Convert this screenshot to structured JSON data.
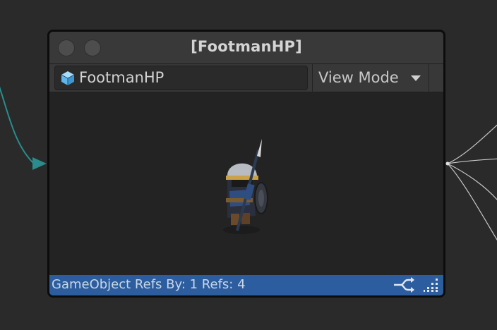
{
  "node": {
    "title": "[FootmanHP]",
    "object_field": {
      "label": "FootmanHP",
      "icon": "prefab-cube-icon"
    },
    "view_mode_label": "View Mode",
    "status": {
      "text": "GameObject Refs By: 1 Refs: 4",
      "link_icon": "link-split-icon",
      "resize_icon": "resize-grip-icon"
    }
  },
  "colors": {
    "canvas_bg": "#2a2a2a",
    "status_bar": "#2c5d9f",
    "incoming_edge": "#2a8c8c",
    "outgoing_edges": "#c0c0c0"
  }
}
